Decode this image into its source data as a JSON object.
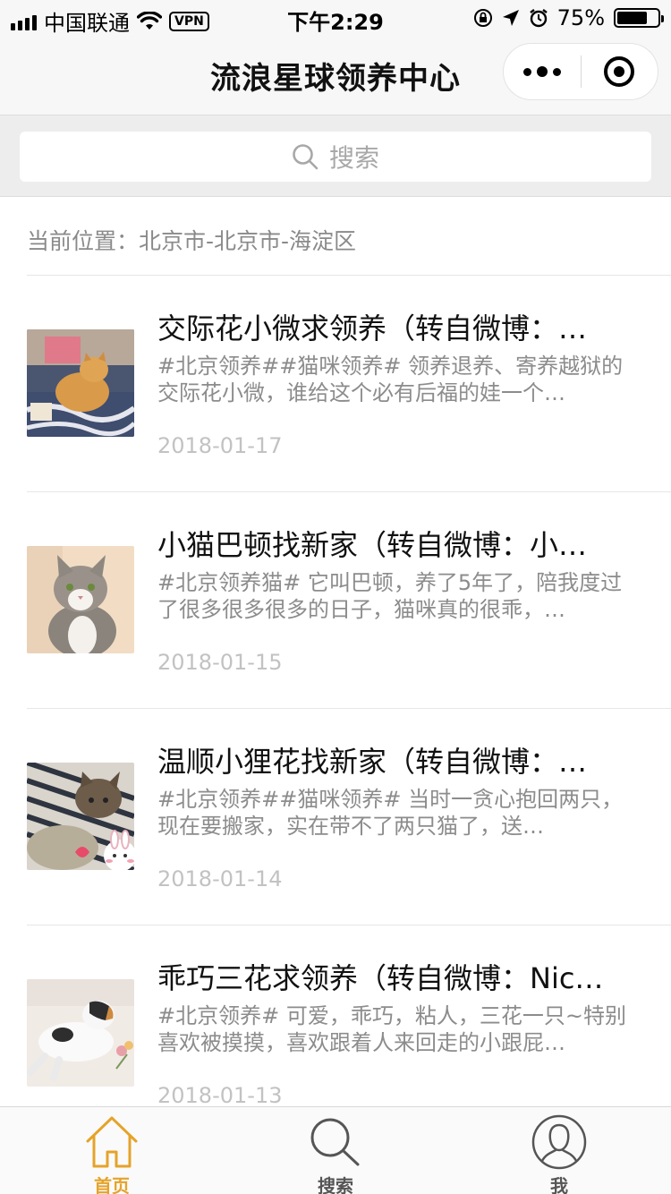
{
  "status_bar": {
    "carrier": "中国联通",
    "vpn": "VPN",
    "time": "下午2:29",
    "battery_percent": "75%",
    "battery_level": 0.75
  },
  "nav": {
    "title": "流浪星球领养中心",
    "more_icon": "more-dots-icon",
    "close_icon": "target-circle-icon"
  },
  "search": {
    "placeholder": "搜索",
    "icon": "search-icon"
  },
  "location": {
    "text": "当前位置：北京市-北京市-海淀区"
  },
  "posts": [
    {
      "title": "交际花小微求领养（转自微博：…",
      "desc": "#北京领养##猫咪领养# 领养退养、寄养越狱的交际花小微，谁给这个必有后福的娃一个…",
      "date": "2018-01-17"
    },
    {
      "title": "小猫巴顿找新家（转自微博：小…",
      "desc": "#北京领养猫# 它叫巴顿，养了5年了，陪我度过了很多很多很多的日子，猫咪真的很乖，…",
      "date": "2018-01-15"
    },
    {
      "title": "温顺小狸花找新家（转自微博：…",
      "desc": "#北京领养##猫咪领养# 当时一贪心抱回两只，现在要搬家，实在带不了两只猫了，送…",
      "date": "2018-01-14"
    },
    {
      "title": "乖巧三花求领养（转自微博：Nic…",
      "desc": "#北京领养# 可爱，乖巧，粘人，三花一只~特别喜欢被摸摸，喜欢跟着人来回走的小跟屁…",
      "date": "2018-01-13"
    }
  ],
  "tabs": [
    {
      "label": "首页",
      "icon": "home-icon",
      "active": true
    },
    {
      "label": "搜索",
      "icon": "search-icon",
      "active": false
    },
    {
      "label": "我",
      "icon": "user-icon",
      "active": false
    }
  ],
  "colors": {
    "accent": "#e5a32a",
    "nav_bg": "#f7f7f7",
    "search_bg": "#ededed"
  }
}
